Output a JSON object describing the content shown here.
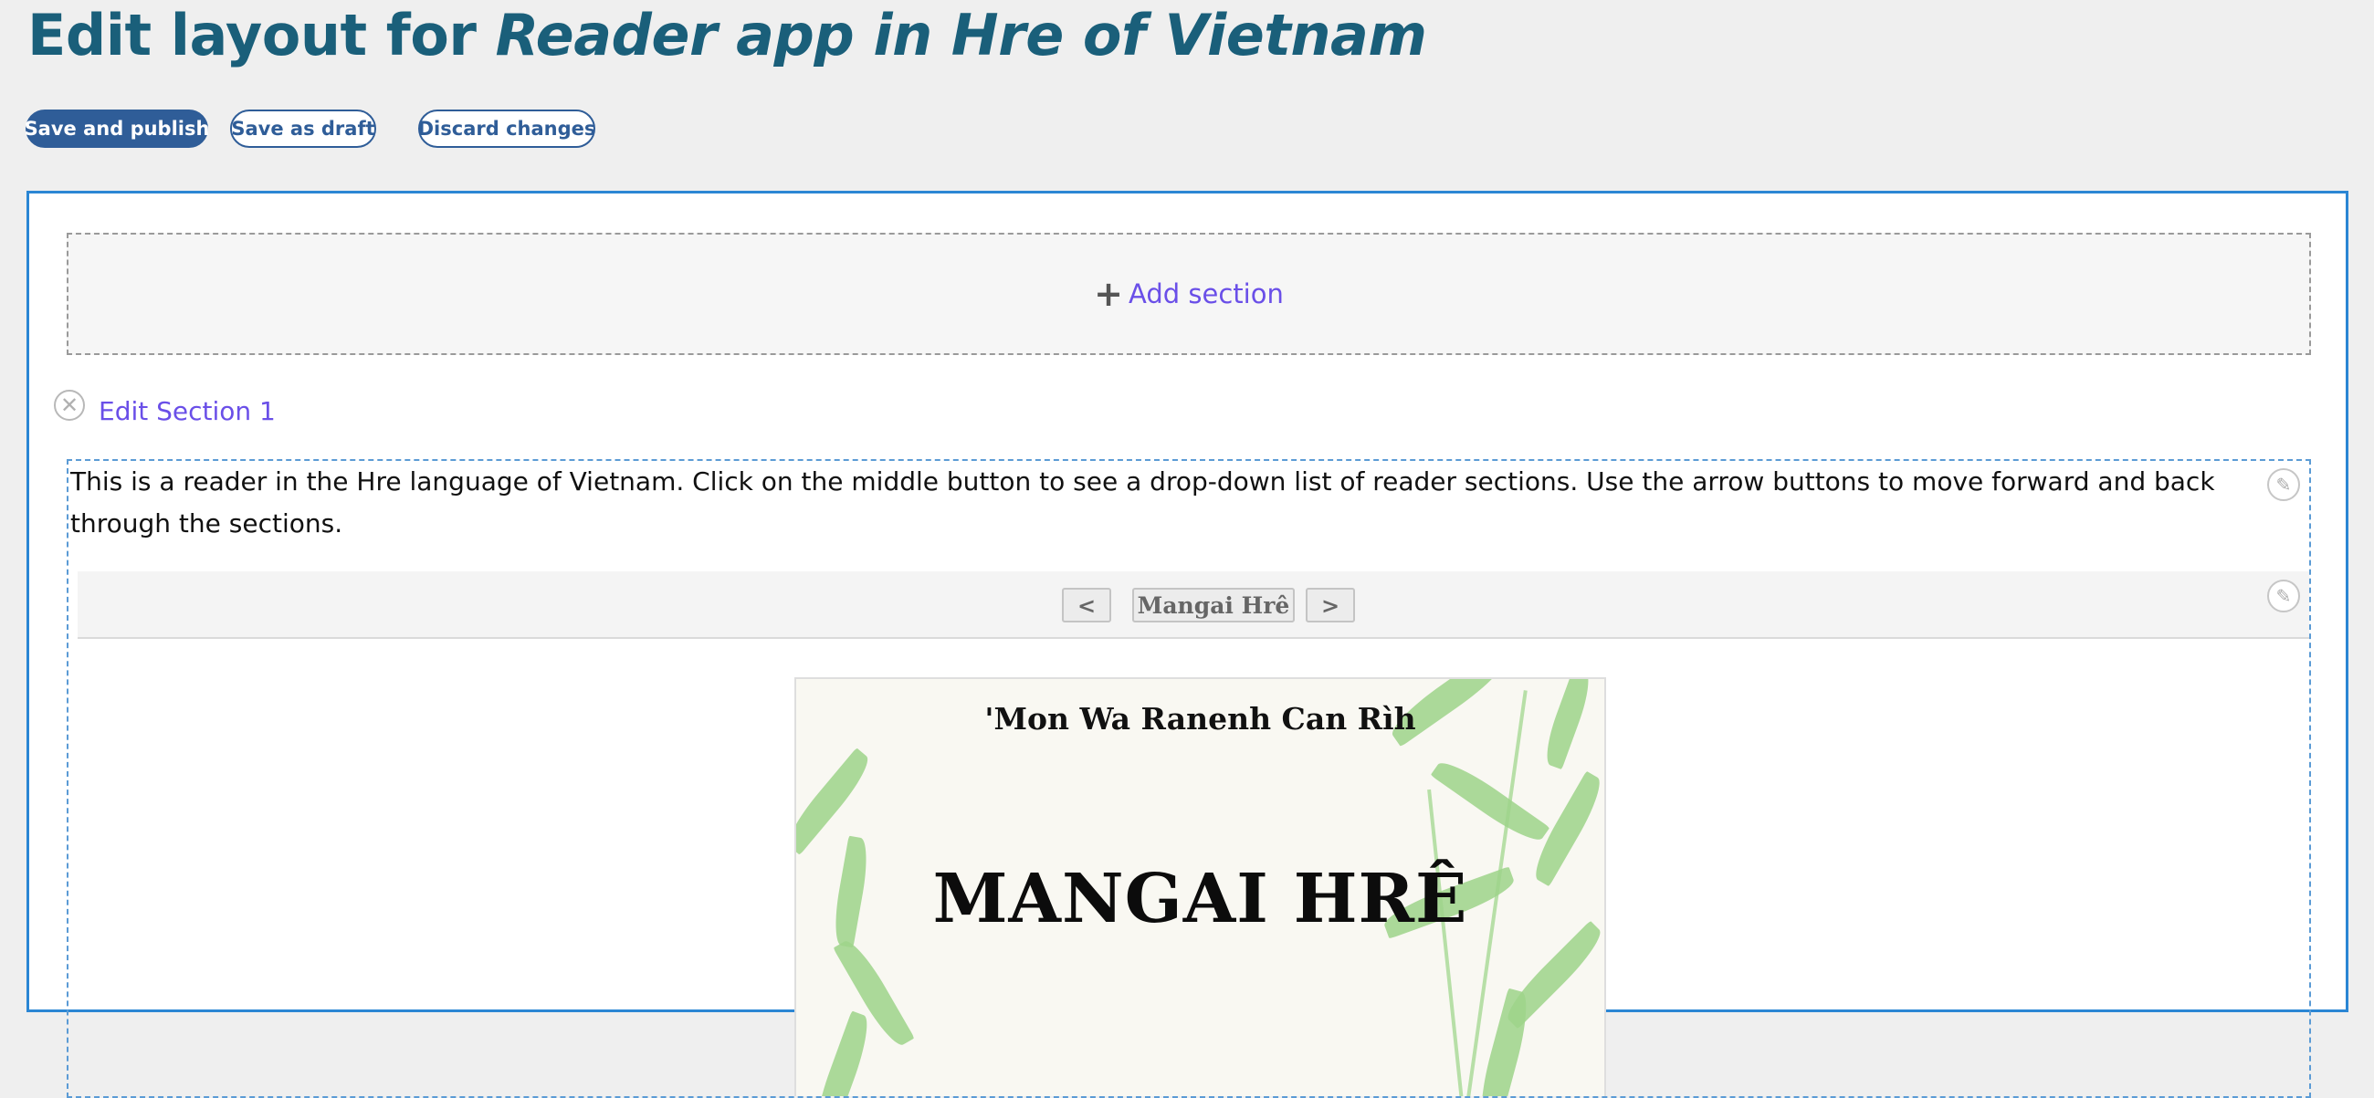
{
  "header": {
    "title_prefix": "Edit layout for",
    "title_app": "Reader app in Hre of Vietnam"
  },
  "toolbar": {
    "save_publish": "Save and publish",
    "save_draft": "Save as draft",
    "discard": "Discard changes"
  },
  "editor": {
    "add_section": "Add section",
    "section_label": "Edit Section 1",
    "intro_text": "This is a reader in the Hre language of Vietnam. Click on the middle button to see a drop-down list of reader sections. Use the arrow buttons to move forward and back through the sections.",
    "nav": {
      "prev": "<",
      "current_section": "Mangai Hrê",
      "next": ">"
    },
    "cover": {
      "subtitle": "'Mon Wa Ranenh Can Rìh",
      "title": "MANGAI HRÊ"
    }
  },
  "colors": {
    "title": "#1a5f7a",
    "primary_button": "#2f5d98",
    "editor_border": "#2b86d4",
    "link": "#6a4fe8"
  }
}
